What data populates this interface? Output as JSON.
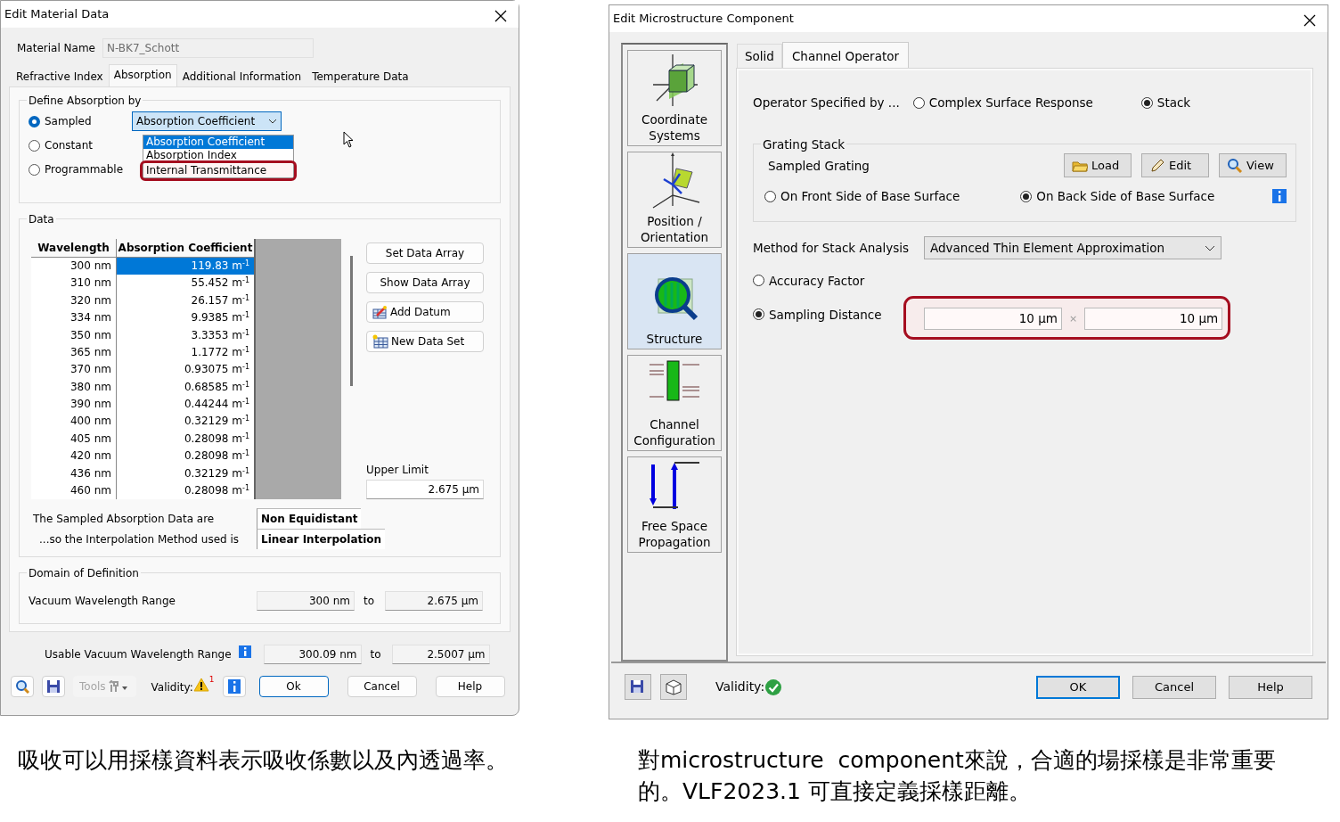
{
  "left_dialog": {
    "title": "Edit Material Data",
    "material_name_label": "Material Name",
    "material_name": "N-BK7_Schott",
    "tabs": [
      {
        "label": "Refractive Index",
        "selected": false
      },
      {
        "label": "Absorption",
        "selected": true
      },
      {
        "label": "Additional Information",
        "selected": false
      },
      {
        "label": "Temperature Data",
        "selected": false
      }
    ],
    "define_group": {
      "title": "Define Absorption by",
      "options": [
        {
          "label": "Sampled",
          "selected": true
        },
        {
          "label": "Constant",
          "selected": false
        },
        {
          "label": "Programmable",
          "selected": false
        }
      ],
      "dropdown": {
        "value": "Absorption Coefficient",
        "items": [
          {
            "label": "Absorption Coefficient",
            "selected": true,
            "highlighted": false
          },
          {
            "label": "Absorption Index",
            "selected": false,
            "highlighted": false
          },
          {
            "label": "Internal Transmittance",
            "selected": false,
            "highlighted": true
          }
        ]
      }
    },
    "data_group": {
      "title": "Data",
      "columns": [
        "Wavelength",
        "Absorption Coefficient"
      ],
      "rows": [
        {
          "wavelength": "300 nm",
          "value": "119.83 m$^{-1}$",
          "selected": true
        },
        {
          "wavelength": "310 nm",
          "value": "55.452 m$^{-1}$",
          "selected": false
        },
        {
          "wavelength": "320 nm",
          "value": "26.157 m$^{-1}$",
          "selected": false
        },
        {
          "wavelength": "334 nm",
          "value": "9.9385 m$^{-1}$",
          "selected": false
        },
        {
          "wavelength": "350 nm",
          "value": "3.3353 m$^{-1}$",
          "selected": false
        },
        {
          "wavelength": "365 nm",
          "value": "1.1772 m$^{-1}$",
          "selected": false
        },
        {
          "wavelength": "370 nm",
          "value": "0.93075 m$^{-1}$",
          "selected": false
        },
        {
          "wavelength": "380 nm",
          "value": "0.68585 m$^{-1}$",
          "selected": false
        },
        {
          "wavelength": "390 nm",
          "value": "0.44244 m$^{-1}$",
          "selected": false
        },
        {
          "wavelength": "400 nm",
          "value": "0.32129 m$^{-1}$",
          "selected": false
        },
        {
          "wavelength": "405 nm",
          "value": "0.28098 m$^{-1}$",
          "selected": false
        },
        {
          "wavelength": "420 nm",
          "value": "0.28098 m$^{-1}$",
          "selected": false
        },
        {
          "wavelength": "436 nm",
          "value": "0.32129 m$^{-1}$",
          "selected": false
        },
        {
          "wavelength": "460 nm",
          "value": "0.28098 m$^{-1}$",
          "selected": false
        }
      ],
      "buttons": [
        {
          "label": "Set Data Array",
          "kind": "plain"
        },
        {
          "label": "Show Data Array",
          "kind": "plain"
        },
        {
          "label": "Add Datum",
          "kind": "add"
        },
        {
          "label": "New Data Set",
          "kind": "table"
        }
      ],
      "upper_limit_label": "Upper Limit",
      "upper_limit": "2.675 µm",
      "sampled_label": "The Sampled Absorption Data are",
      "sampled_value": "Non Equidistant",
      "interpolation_label": "...so the Interpolation Method used is",
      "interpolation_value": "Linear Interpolation"
    },
    "domain_group": {
      "title": "Domain of Definition",
      "range_label": "Vacuum Wavelength Range",
      "from": "300 nm",
      "to_word": "to",
      "to": "2.675 µm"
    },
    "usable": {
      "label": "Usable Vacuum Wavelength Range",
      "from": "300.09 nm",
      "to_word": "to",
      "to": "2.5007 µm"
    },
    "footer": {
      "tools_label": "Tools",
      "tools_disabled": true,
      "validity_label": "Validity:",
      "warning_count": "1",
      "buttons": [
        {
          "label": "Ok",
          "default": true
        },
        {
          "label": "Cancel",
          "default": false
        },
        {
          "label": "Help",
          "default": false
        }
      ]
    }
  },
  "right_dialog": {
    "title": "Edit Microstructure Component",
    "sidebar": [
      {
        "label": "Coordinate Systems",
        "kind": "coordinates",
        "selected": false
      },
      {
        "label": "Position / Orientation",
        "kind": "position",
        "selected": false
      },
      {
        "label": "Structure",
        "kind": "structure",
        "selected": true
      },
      {
        "label": "Channel Configuration",
        "kind": "channel",
        "selected": false
      },
      {
        "label": "Free Space Propagation",
        "kind": "propagation",
        "selected": false
      }
    ],
    "tabs": [
      {
        "label": "Solid",
        "selected": false
      },
      {
        "label": "Channel Operator",
        "selected": true
      }
    ],
    "operator_label": "Operator Specified by ...",
    "operator_options": [
      {
        "label": "Complex Surface Response",
        "selected": false
      },
      {
        "label": "Stack",
        "selected": true
      }
    ],
    "grating_group": {
      "title": "Grating Stack",
      "name": "Sampled Grating",
      "buttons": [
        {
          "label": "Load",
          "kind": "folder"
        },
        {
          "label": "Edit",
          "kind": "pencil"
        },
        {
          "label": "View",
          "kind": "magnifier"
        }
      ],
      "side_options": [
        {
          "label": "On Front Side of Base Surface",
          "selected": false
        },
        {
          "label": "On Back Side of Base Surface",
          "selected": true
        }
      ]
    },
    "method_label": "Method for Stack Analysis",
    "method_value": "Advanced Thin Element Approximation",
    "sampling_options": [
      {
        "label": "Accuracy Factor",
        "selected": false
      },
      {
        "label": "Sampling Distance",
        "selected": true
      }
    ],
    "sampling": {
      "x": "10 µm",
      "separator": "×",
      "y": "10 µm",
      "highlighted": true
    },
    "footer": {
      "validity_label": "Validity:",
      "valid": true,
      "buttons": [
        {
          "label": "OK",
          "default": true
        },
        {
          "label": "Cancel",
          "default": false
        },
        {
          "label": "Help",
          "default": false
        }
      ]
    }
  },
  "captions": [
    "吸收可以用採樣資料表示吸收係數以及內透過率。",
    "對microstructure  component來說，合適的場採樣是非常重要的。VLF2023.1 可直接定義採樣距離。"
  ]
}
